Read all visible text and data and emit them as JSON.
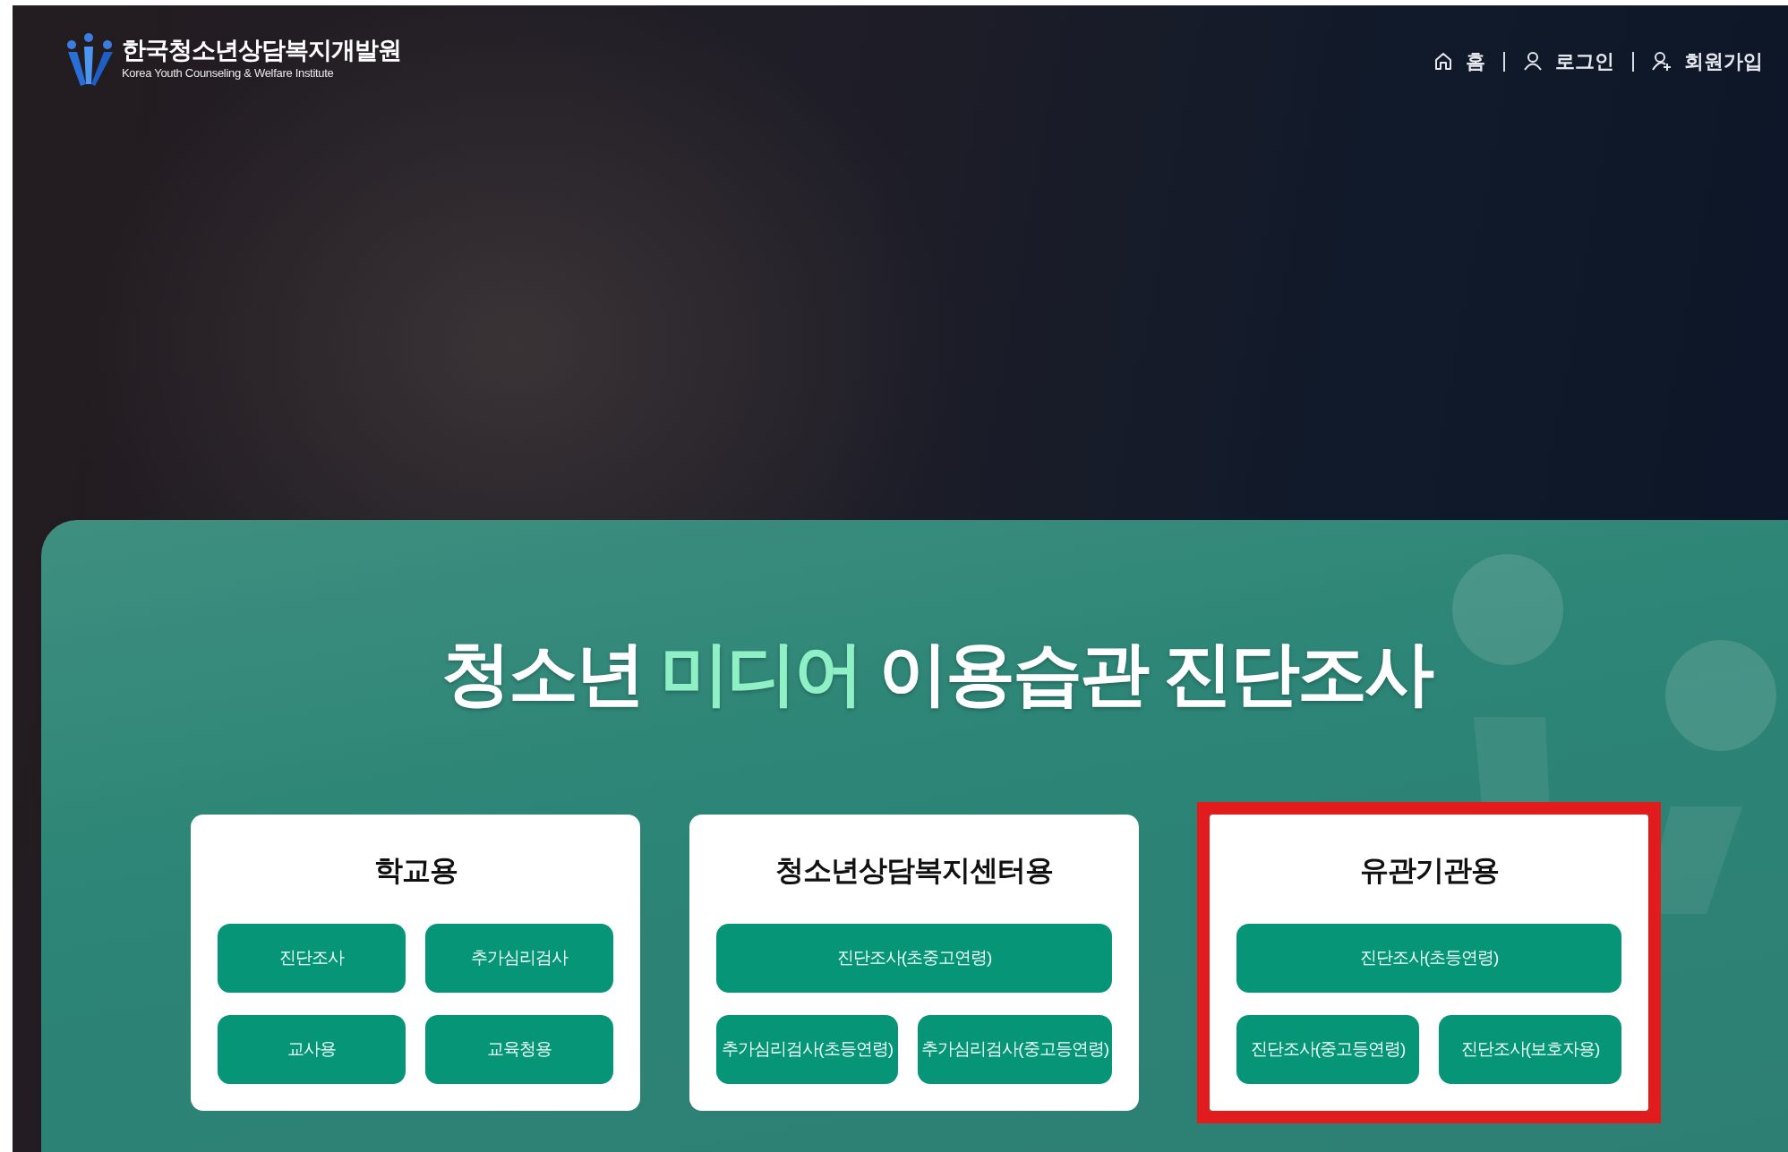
{
  "header": {
    "logo": {
      "name": "한국청소년상담복지개발원",
      "subtitle": "Korea Youth Counseling & Welfare Institute"
    },
    "nav": [
      {
        "kind": "home",
        "label": "홈"
      },
      {
        "kind": "login",
        "label": "로그인"
      },
      {
        "kind": "join",
        "label": "회원가입"
      }
    ]
  },
  "hero": {
    "title": [
      {
        "text": "청소년 ",
        "accent": false
      },
      {
        "text": "미디어",
        "accent": true
      },
      {
        "text": " 이용습관 진단조사",
        "accent": false
      }
    ]
  },
  "cards": [
    {
      "title": "학교용",
      "highlighted": false,
      "rows": [
        [
          "진단조사",
          "추가심리검사"
        ],
        [
          "교사용",
          "교육청용"
        ]
      ]
    },
    {
      "title": "청소년상담복지센터용",
      "highlighted": false,
      "rows": [
        [
          "진단조사(초중고연령)"
        ],
        [
          "추가심리검사(초등연령)",
          "추가심리검사(중고등연령)"
        ]
      ]
    },
    {
      "title": "유관기관용",
      "highlighted": true,
      "rows": [
        [
          "진단조사(초등연령)"
        ],
        [
          "진단조사(중고등연령)",
          "진단조사(보호자용)"
        ]
      ]
    }
  ]
}
